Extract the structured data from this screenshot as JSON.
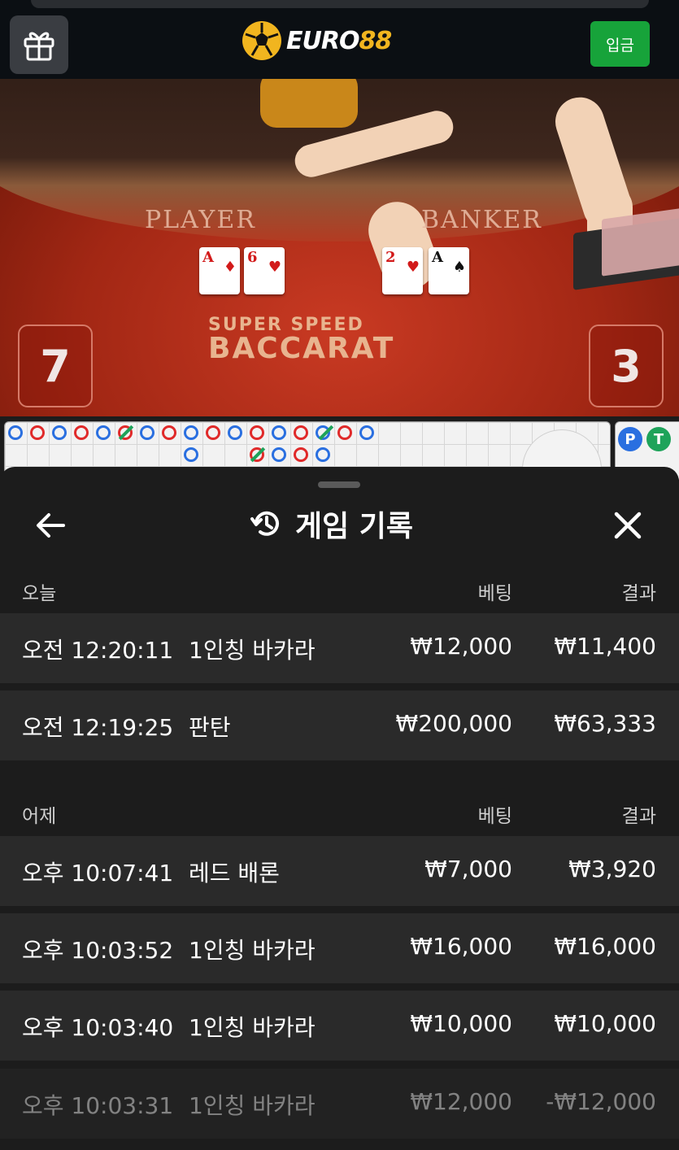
{
  "header": {
    "logo_text_main": "EURO",
    "logo_text_num": "88",
    "gift_icon": "gift-icon",
    "deposit_label": "입금",
    "deposit_color": "#17a33a",
    "logo_color": "#f1b51f"
  },
  "game_view": {
    "player_label": "PLAYER",
    "banker_label": "BANKER",
    "brand_line1": "SUPER SPEED",
    "brand_line2": "BACCARAT",
    "player_score": "7",
    "banker_score": "3",
    "player_cards": [
      {
        "rank": "A",
        "suit": "♦"
      },
      {
        "rank": "6",
        "suit": "♥"
      }
    ],
    "banker_cards": [
      {
        "rank": "2",
        "suit": "♥"
      },
      {
        "rank": "A",
        "suit": "♠"
      }
    ],
    "bead_labels": [
      "P",
      "T"
    ]
  },
  "history": {
    "title": "게임 기록",
    "history_icon": "history-clock-icon",
    "back_icon": "arrow-left-icon",
    "close_icon": "close-icon",
    "sections": [
      {
        "label": "오늘",
        "bet_header": "베팅",
        "result_header": "결과",
        "rows": [
          {
            "time": "오전 12:20:11",
            "game": "1인칭 바카라",
            "bet": "₩12,000",
            "result": "₩11,400"
          },
          {
            "time": "오전 12:19:25",
            "game": "판탄",
            "bet": "₩200,000",
            "result": "₩63,333"
          }
        ]
      },
      {
        "label": "어제",
        "bet_header": "베팅",
        "result_header": "결과",
        "rows": [
          {
            "time": "오후 10:07:41",
            "game": "레드 배론",
            "bet": "₩7,000",
            "result": "₩3,920"
          },
          {
            "time": "오후 10:03:52",
            "game": "1인칭 바카라",
            "bet": "₩16,000",
            "result": "₩16,000"
          },
          {
            "time": "오후 10:03:40",
            "game": "1인칭 바카라",
            "bet": "₩10,000",
            "result": "₩10,000"
          },
          {
            "time": "오후 10:03:31",
            "game": "1인칭 바카라",
            "bet": "₩12,000",
            "result": "-₩12,000"
          }
        ]
      }
    ]
  }
}
